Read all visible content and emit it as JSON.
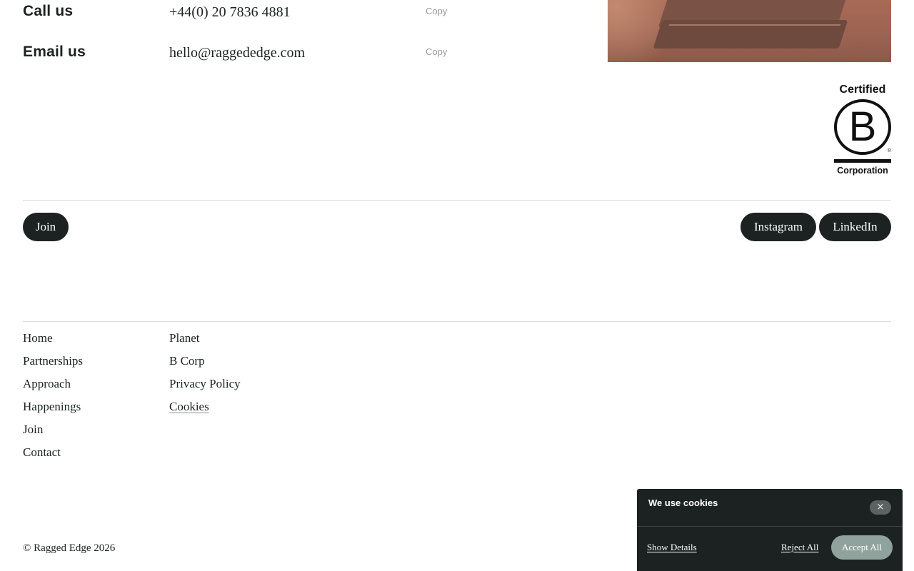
{
  "contact": {
    "call": {
      "label": "Call us",
      "value": "+44(0) 20 7836 4881",
      "copy_label": "Copy"
    },
    "email": {
      "label": "Email us",
      "value": "hello@raggededge.com",
      "copy_label": "Copy"
    }
  },
  "bcorp": {
    "top_text": "Certified",
    "letter": "B",
    "registered": "®",
    "bottom_text": "Corporation"
  },
  "actions": {
    "join_label": "Join",
    "instagram_label": "Instagram",
    "linkedin_label": "LinkedIn"
  },
  "footer": {
    "column1": [
      "Home",
      "Partnerships",
      "Approach",
      "Happenings",
      "Join",
      "Contact"
    ],
    "column2": [
      "Planet",
      "B Corp",
      "Privacy Policy",
      "Cookies"
    ],
    "copyright": "© Ragged Edge 2026"
  },
  "cookie_banner": {
    "title": "We use cookies",
    "close_icon": "×",
    "show_details_label": "Show Details",
    "reject_label": "Reject All",
    "accept_label": "Accept All"
  },
  "colors": {
    "ink": "#1c2221",
    "muted": "#9a9a9a",
    "divider": "#dcdcdc",
    "accept_button": "#8fa39c"
  }
}
